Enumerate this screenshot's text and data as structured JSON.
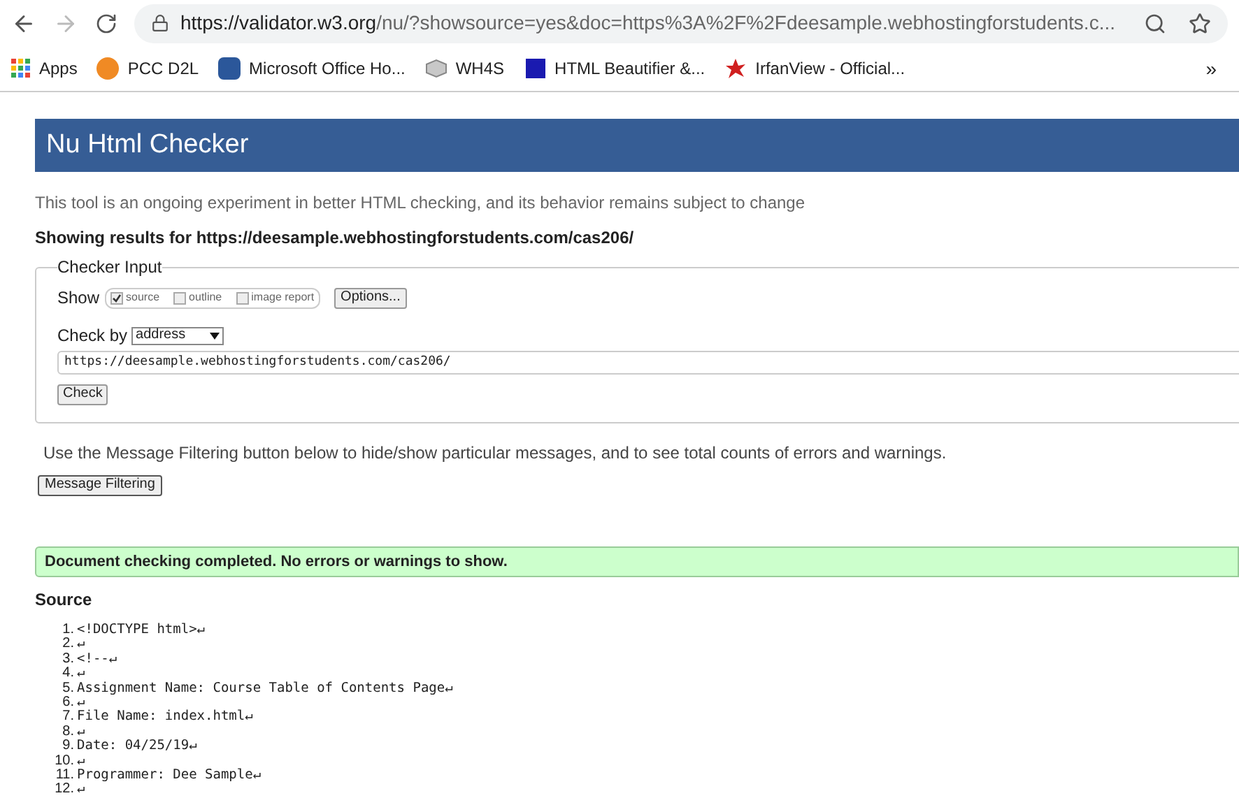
{
  "browser": {
    "url_host": "https://validator.w3.org",
    "url_path": "/nu/?showsource=yes&doc=https%3A%2F%2Fdeesample.webhostingforstudents.c...",
    "bookmarks": [
      {
        "label": "Apps",
        "kind": "apps"
      },
      {
        "label": "PCC D2L",
        "kind": "d2l"
      },
      {
        "label": "Microsoft Office Ho...",
        "kind": "word"
      },
      {
        "label": "WH4S",
        "kind": "wh4s"
      },
      {
        "label": "HTML Beautifier &...",
        "kind": "dans"
      },
      {
        "label": "IrfanView - Official...",
        "kind": "irfan"
      }
    ],
    "overflow": "»"
  },
  "page": {
    "title": "Nu Html Checker",
    "intro": "This tool is an ongoing experiment in better HTML checking, and its behavior remains subject to change",
    "showing": "Showing results for https://deesample.webhostingforstudents.com/cas206/",
    "checker": {
      "legend": "Checker Input",
      "show_label": "Show",
      "show_options": [
        {
          "label": "source",
          "checked": true
        },
        {
          "label": "outline",
          "checked": false
        },
        {
          "label": "image report",
          "checked": false
        }
      ],
      "options_button": "Options...",
      "check_by_label": "Check by",
      "check_by_value": "address",
      "address_value": "https://deesample.webhostingforstudents.com/cas206/",
      "check_button": "Check"
    },
    "filter_note": "Use the Message Filtering button below to hide/show particular messages, and to see total counts of errors and warnings.",
    "filter_button": "Message Filtering",
    "success": "Document checking completed. No errors or warnings to show.",
    "source_heading": "Source",
    "source_lines": [
      {
        "number": "1.",
        "text": "<!DOCTYPE html>↵"
      },
      {
        "number": "2.",
        "text": "↵"
      },
      {
        "number": "3.",
        "text": "<!--↵"
      },
      {
        "number": "4.",
        "text": "↵"
      },
      {
        "number": "5.",
        "text": "Assignment Name: Course Table of Contents Page↵"
      },
      {
        "number": "6.",
        "text": "↵"
      },
      {
        "number": "7.",
        "text": "File Name: index.html↵"
      },
      {
        "number": "8.",
        "text": "↵"
      },
      {
        "number": "9.",
        "text": "Date: 04/25/19↵"
      },
      {
        "number": "10.",
        "text": "↵"
      },
      {
        "number": "11.",
        "text": "Programmer: Dee Sample↵"
      },
      {
        "number": "12.",
        "text": "↵"
      }
    ]
  }
}
